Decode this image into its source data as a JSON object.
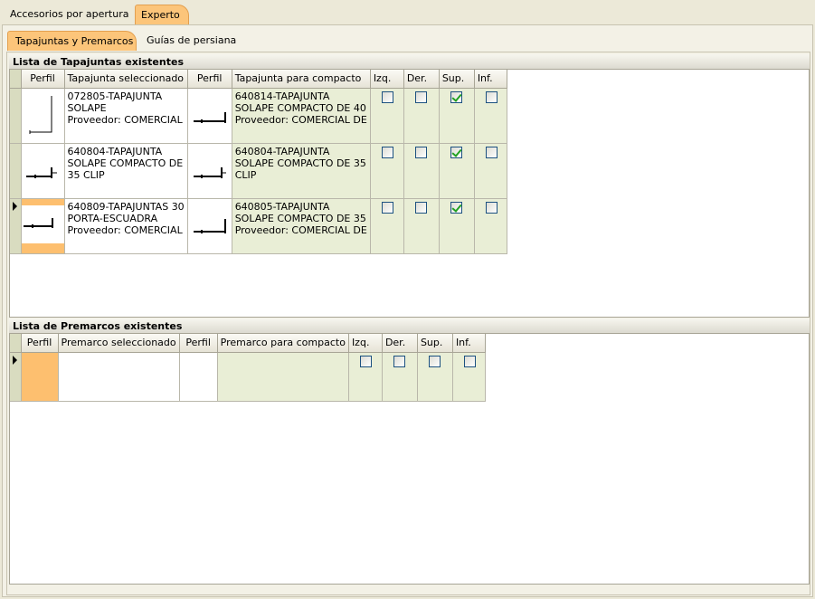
{
  "top_tabs": [
    "Accesorios por apertura",
    "Experto"
  ],
  "sub_tabs": [
    "Tapajuntas y Premarcos",
    "Guías de persiana"
  ],
  "tapajuntas": {
    "title": "Lista de Tapajuntas existentes",
    "columns": [
      "Perfil",
      "Tapajunta seleccionado",
      "Perfil",
      "Tapajunta para compacto",
      "Izq.",
      "Der.",
      "Sup.",
      "Inf."
    ],
    "rows": [
      {
        "sel": [
          "072805-TAPAJUNTA",
          "SOLAPE",
          "Proveedor: COMERCIAL"
        ],
        "compact": [
          "640814-TAPAJUNTA",
          "SOLAPE COMPACTO DE 40",
          "Proveedor: COMERCIAL DE"
        ],
        "izq": false,
        "der": false,
        "sup": true,
        "inf": false
      },
      {
        "sel": [
          "640804-TAPAJUNTA",
          "SOLAPE COMPACTO DE",
          "35 CLIP"
        ],
        "compact": [
          "640804-TAPAJUNTA",
          "SOLAPE COMPACTO DE 35",
          "CLIP"
        ],
        "izq": false,
        "der": false,
        "sup": true,
        "inf": false
      },
      {
        "sel": [
          "640809-TAPAJUNTAS 30",
          "PORTA-ESCUADRA",
          "Proveedor: COMERCIAL"
        ],
        "compact": [
          "640805-TAPAJUNTA",
          "SOLAPE COMPACTO DE 35",
          "Proveedor: COMERCIAL DE"
        ],
        "izq": false,
        "der": false,
        "sup": true,
        "inf": false
      }
    ]
  },
  "premarcos": {
    "title": "Lista de Premarcos existentes",
    "columns": [
      "Perfil",
      "Premarco seleccionado",
      "Perfil",
      "Premarco para compacto",
      "Izq.",
      "Der.",
      "Sup.",
      "Inf."
    ],
    "rows": [
      {
        "izq": false,
        "der": false,
        "sup": false,
        "inf": false
      }
    ]
  },
  "colors": {
    "active_tab": "#fcc57a",
    "compact_bg": "#e9eed6",
    "selected_profile": "#fdbf6f",
    "check": "#21a121"
  }
}
